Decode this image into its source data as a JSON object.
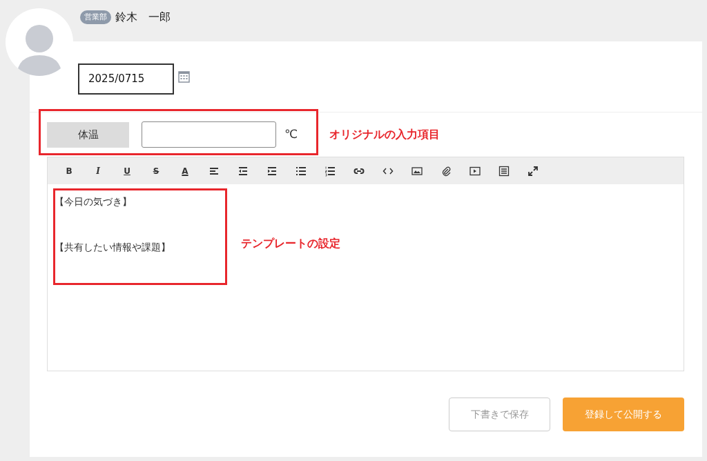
{
  "user": {
    "department": "営業部",
    "name": "鈴木　一郎"
  },
  "date_field": {
    "value": "2025/0715"
  },
  "temperature": {
    "label": "体温",
    "unit": "℃"
  },
  "toolbar": [
    {
      "kind": "bold",
      "label": "B"
    },
    {
      "kind": "italic",
      "label": "I"
    },
    {
      "kind": "underline",
      "label": "U"
    },
    {
      "kind": "strike",
      "label": "S"
    },
    {
      "kind": "color",
      "label": "A"
    },
    {
      "kind": "align"
    },
    {
      "kind": "outdent"
    },
    {
      "kind": "indent"
    },
    {
      "kind": "bullets"
    },
    {
      "kind": "numbers"
    },
    {
      "kind": "link"
    },
    {
      "kind": "code"
    },
    {
      "kind": "image"
    },
    {
      "kind": "attach"
    },
    {
      "kind": "video"
    },
    {
      "kind": "block"
    },
    {
      "kind": "fullscreen"
    }
  ],
  "editor": {
    "lines": [
      "【今日の気づき】",
      "【共有したい情報や課題】"
    ]
  },
  "buttons": [
    {
      "kind": "secondary",
      "label": "下書きで保存"
    },
    {
      "kind": "primary",
      "label": "登録して公開する"
    }
  ],
  "annotations": [
    "オリジナルの入力項目",
    "テンプレートの設定"
  ]
}
